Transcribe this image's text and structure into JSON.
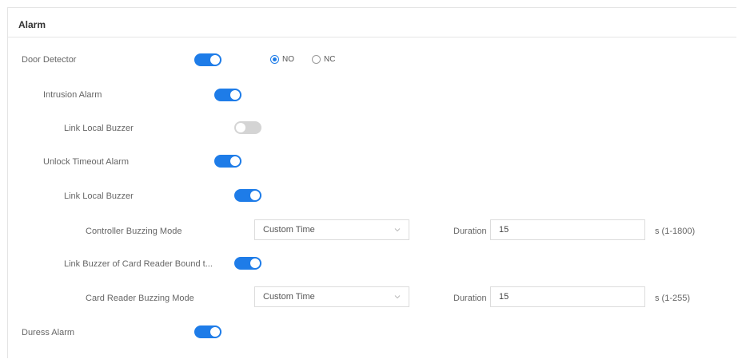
{
  "section": {
    "title": "Alarm"
  },
  "door_detector": {
    "label": "Door Detector",
    "enabled": true,
    "options": [
      {
        "label": "NO",
        "selected": true
      },
      {
        "label": "NC",
        "selected": false
      }
    ]
  },
  "intrusion_alarm": {
    "label": "Intrusion Alarm",
    "enabled": true,
    "link_local_buzzer": {
      "label": "Link Local Buzzer",
      "enabled": false
    }
  },
  "unlock_timeout_alarm": {
    "label": "Unlock Timeout Alarm",
    "enabled": true,
    "link_local_buzzer": {
      "label": "Link Local Buzzer",
      "enabled": true
    },
    "controller_buzzing": {
      "label": "Controller Buzzing Mode",
      "mode": "Custom Time",
      "duration_label": "Duration",
      "duration_value": "15",
      "range": "s (1-1800)"
    },
    "link_card_reader": {
      "label": "Link Buzzer of Card Reader Bound t...",
      "enabled": true
    },
    "card_reader_buzzing": {
      "label": "Card Reader Buzzing Mode",
      "mode": "Custom Time",
      "duration_label": "Duration",
      "duration_value": "15",
      "range": "s (1-255)"
    }
  },
  "duress_alarm": {
    "label": "Duress Alarm",
    "enabled": true
  },
  "colors": {
    "accent": "#1e7ce8",
    "toggle_off": "#d4d4d4"
  }
}
